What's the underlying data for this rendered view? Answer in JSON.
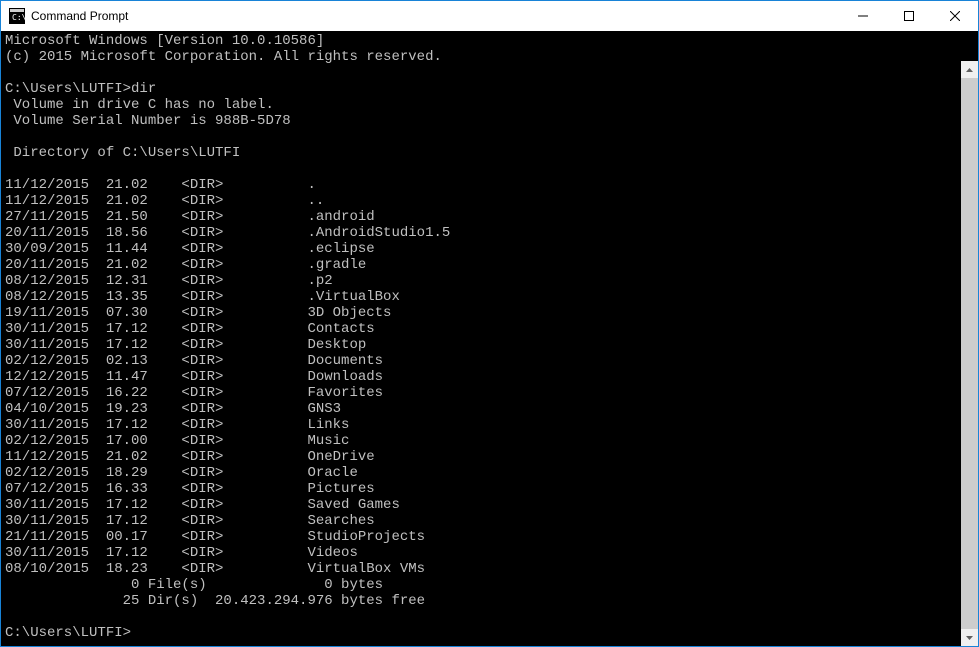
{
  "window": {
    "title": "Command Prompt"
  },
  "header": {
    "line1": "Microsoft Windows [Version 10.0.10586]",
    "line2": "(c) 2015 Microsoft Corporation. All rights reserved."
  },
  "prompt1": {
    "path": "C:\\Users\\LUTFI>",
    "command": "dir"
  },
  "volume": {
    "line1": " Volume in drive C has no label.",
    "line2": " Volume Serial Number is 988B-5D78"
  },
  "directory_header": " Directory of C:\\Users\\LUTFI",
  "entries": [
    {
      "date": "11/12/2015",
      "time": "21.02",
      "type": "<DIR>",
      "name": "."
    },
    {
      "date": "11/12/2015",
      "time": "21.02",
      "type": "<DIR>",
      "name": ".."
    },
    {
      "date": "27/11/2015",
      "time": "21.50",
      "type": "<DIR>",
      "name": ".android"
    },
    {
      "date": "20/11/2015",
      "time": "18.56",
      "type": "<DIR>",
      "name": ".AndroidStudio1.5"
    },
    {
      "date": "30/09/2015",
      "time": "11.44",
      "type": "<DIR>",
      "name": ".eclipse"
    },
    {
      "date": "20/11/2015",
      "time": "21.02",
      "type": "<DIR>",
      "name": ".gradle"
    },
    {
      "date": "08/12/2015",
      "time": "12.31",
      "type": "<DIR>",
      "name": ".p2"
    },
    {
      "date": "08/12/2015",
      "time": "13.35",
      "type": "<DIR>",
      "name": ".VirtualBox"
    },
    {
      "date": "19/11/2015",
      "time": "07.30",
      "type": "<DIR>",
      "name": "3D Objects"
    },
    {
      "date": "30/11/2015",
      "time": "17.12",
      "type": "<DIR>",
      "name": "Contacts"
    },
    {
      "date": "30/11/2015",
      "time": "17.12",
      "type": "<DIR>",
      "name": "Desktop"
    },
    {
      "date": "02/12/2015",
      "time": "02.13",
      "type": "<DIR>",
      "name": "Documents"
    },
    {
      "date": "12/12/2015",
      "time": "11.47",
      "type": "<DIR>",
      "name": "Downloads"
    },
    {
      "date": "07/12/2015",
      "time": "16.22",
      "type": "<DIR>",
      "name": "Favorites"
    },
    {
      "date": "04/10/2015",
      "time": "19.23",
      "type": "<DIR>",
      "name": "GNS3"
    },
    {
      "date": "30/11/2015",
      "time": "17.12",
      "type": "<DIR>",
      "name": "Links"
    },
    {
      "date": "02/12/2015",
      "time": "17.00",
      "type": "<DIR>",
      "name": "Music"
    },
    {
      "date": "11/12/2015",
      "time": "21.02",
      "type": "<DIR>",
      "name": "OneDrive"
    },
    {
      "date": "02/12/2015",
      "time": "18.29",
      "type": "<DIR>",
      "name": "Oracle"
    },
    {
      "date": "07/12/2015",
      "time": "16.33",
      "type": "<DIR>",
      "name": "Pictures"
    },
    {
      "date": "30/11/2015",
      "time": "17.12",
      "type": "<DIR>",
      "name": "Saved Games"
    },
    {
      "date": "30/11/2015",
      "time": "17.12",
      "type": "<DIR>",
      "name": "Searches"
    },
    {
      "date": "21/11/2015",
      "time": "00.17",
      "type": "<DIR>",
      "name": "StudioProjects"
    },
    {
      "date": "30/11/2015",
      "time": "17.12",
      "type": "<DIR>",
      "name": "Videos"
    },
    {
      "date": "08/10/2015",
      "time": "18.23",
      "type": "<DIR>",
      "name": "VirtualBox VMs"
    }
  ],
  "summary": {
    "files": "               0 File(s)              0 bytes",
    "dirs": "              25 Dir(s)  20.423.294.976 bytes free"
  },
  "prompt2": {
    "path": "C:\\Users\\LUTFI>"
  }
}
